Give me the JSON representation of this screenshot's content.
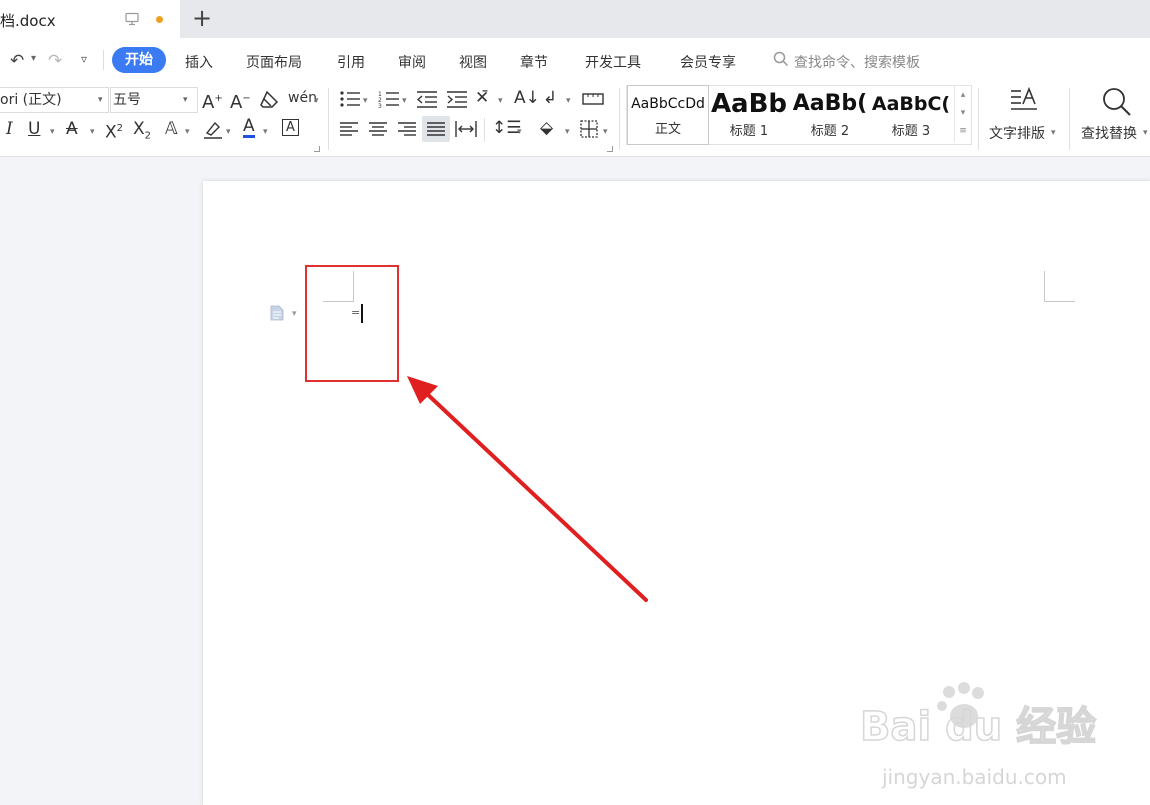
{
  "tab": {
    "title": "档.docx"
  },
  "menu": {
    "items": [
      "开始",
      "插入",
      "页面布局",
      "引用",
      "审阅",
      "视图",
      "章节",
      "开发工具",
      "会员专享"
    ],
    "search_placeholder": "查找命令、搜索模板"
  },
  "ribbon": {
    "font_name": "ori (正文)",
    "font_size": "五号",
    "styles": [
      {
        "preview": "AaBbCcDd",
        "label": "正文"
      },
      {
        "preview": "AaBb",
        "label": "标题 1"
      },
      {
        "preview": "AaBb(",
        "label": "标题 2"
      },
      {
        "preview": "AaBbC(",
        "label": "标题 3"
      }
    ],
    "text_layout_label": "文字排版",
    "find_replace_label": "查找替换",
    "pinyin_glyph": "wén",
    "font_color_letter": "A"
  },
  "document": {
    "equation_mark": "="
  },
  "colors": {
    "accent": "#3a7af2",
    "highlight_box": "#e03030",
    "arrow": "#e02020",
    "modified_dot": "#f0a020",
    "font_color_underline": "#2050e0"
  },
  "watermark": {
    "brand": "Bai du 经验",
    "url": "jingyan.baidu.com"
  }
}
